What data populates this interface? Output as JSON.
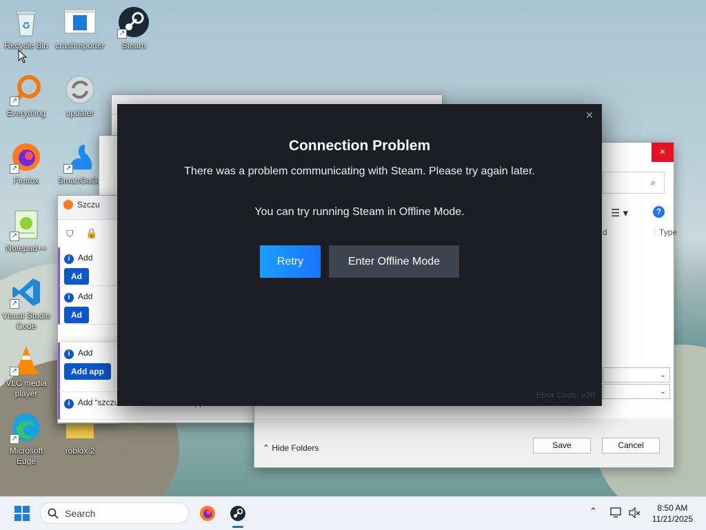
{
  "desktop": {
    "icons": [
      {
        "label": "Recycle Bin"
      },
      {
        "label": "crashreporter"
      },
      {
        "label": "Steam"
      },
      {
        "label": "Everything"
      },
      {
        "label": "updater"
      },
      {
        "label": "Firefox"
      },
      {
        "label": "SmartGaGa"
      },
      {
        "label": "Notepad++"
      },
      {
        "label": "Visual Studio Code"
      },
      {
        "label": "VLC media player"
      },
      {
        "label": "Microsoft Edge"
      },
      {
        "label": "roblox 2"
      }
    ]
  },
  "firefox_window": {
    "tab_title": "Szczu",
    "notifications": [
      {
        "text": "Add",
        "button": "Ad"
      },
      {
        "text": "Add",
        "button": "Ad"
      },
      {
        "text": "Add",
        "button": "Add app"
      },
      {
        "text": "Add “szczuras.monster” as an application for irc"
      }
    ]
  },
  "file_dialog": {
    "close_symbol": "×",
    "col_name_fragment": "d",
    "col_type": "Type",
    "hide_folders": "Hide Folders",
    "save": "Save",
    "cancel": "Cancel"
  },
  "steam_dialog": {
    "title": "Connection Problem",
    "message": "There was a problem communicating with Steam. Please try again later.",
    "offline_hint": "You can try running Steam in Offline Mode.",
    "retry_label": "Retry",
    "offline_label": "Enter Offline Mode",
    "error_code": "Error Code: e20",
    "close_symbol": "×"
  },
  "taskbar": {
    "search_placeholder": "Search",
    "time": "8:50 AM",
    "date": "11/21/2025"
  }
}
